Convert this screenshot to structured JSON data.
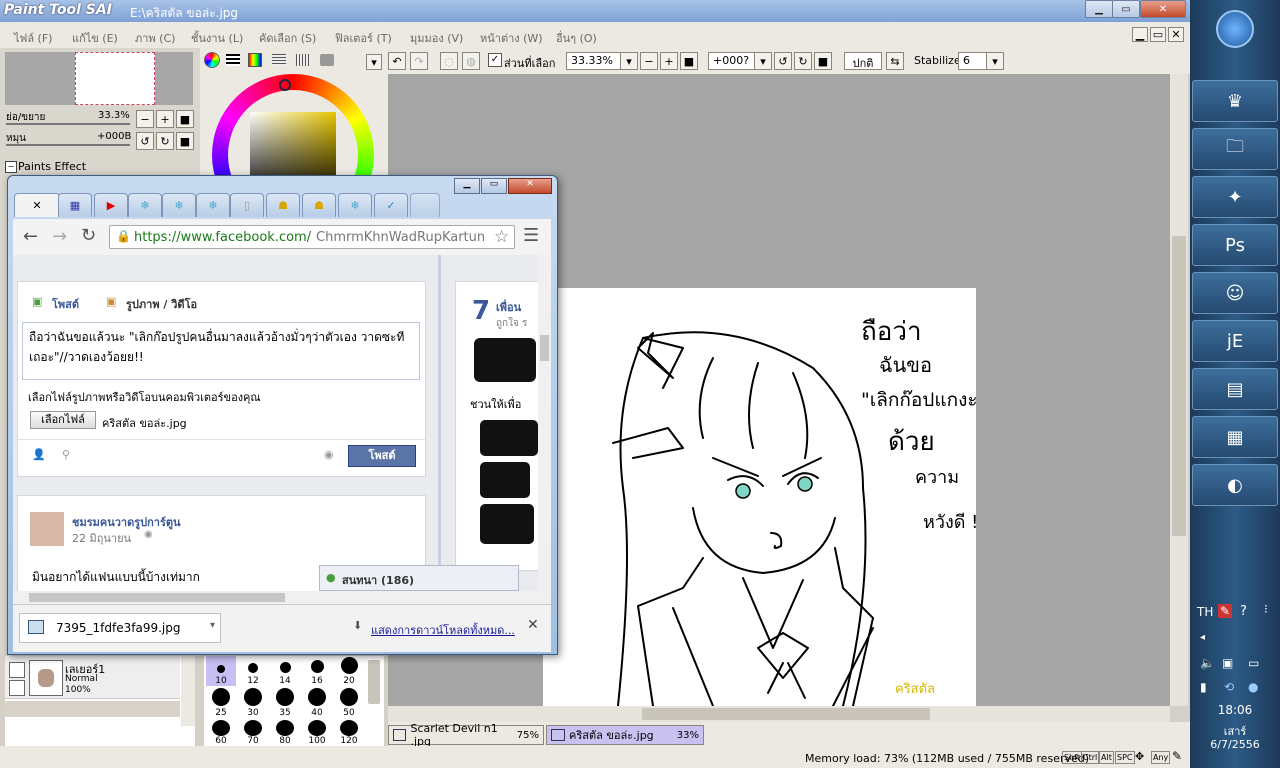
{
  "sai": {
    "logo": "Paint Tool SAI",
    "file_path": "E:\\คริสตัล ขอล่ะ.jpg",
    "menu": [
      "ไฟล์ (F)",
      "แก้ไข (E)",
      "ภาพ (C)",
      "ชั้นงาน (L)",
      "คัดเลือก (S)",
      "ฟิลเตอร์ (T)",
      "มุมมอง (V)",
      "หน้าต่าง (W)",
      "อื่นๆ (O)"
    ],
    "toolbar": {
      "selection_label": "ส่วนที่เลือก",
      "zoom": "33.33%",
      "rotation": "+000?",
      "mode": "ปกติ",
      "stabilize_label": "Stabilize",
      "stabilize_value": "6"
    },
    "navigator": {
      "zoom_label": "ย่อ/ขยาย",
      "zoom_value": "33.3%",
      "rotate_label": "หมุน",
      "rotate_value": "+000B",
      "paints_effect": "Paints Effect"
    },
    "layer": {
      "name": "เลเยอร์1",
      "mode": "Normal",
      "opacity": "100%"
    },
    "brush_sizes": [
      "10",
      "12",
      "14",
      "16",
      "20",
      "25",
      "30",
      "35",
      "40",
      "50",
      "60",
      "70",
      "80",
      "100",
      "120"
    ],
    "doc_tabs": [
      {
        "name": "Scarlet Devil n1 .jpg",
        "zoom": "75%"
      },
      {
        "name": "คริสตัล ขอล่ะ.jpg",
        "zoom": "33%"
      }
    ],
    "status": "Memory load: 73% (112MB used / 755MB reserved)",
    "status_keys": [
      "Shft",
      "Ctrl",
      "Alt",
      "SPC",
      "Any"
    ],
    "canvas_text": {
      "line1": "ถือว่า",
      "line2": "ฉันขอ",
      "line3": "\"เลิกก๊อปแกงะ",
      "line4": "ด้วย",
      "line5": "ความ",
      "line6": "หวังดี !",
      "signature": "คริสตัล"
    }
  },
  "browser": {
    "url_host": "https://www.facebook.com/",
    "url_path": "ChmrmKhnWadRupKartun",
    "composer": {
      "tab_post": "โพสต์",
      "tab_photo": "รูปภาพ / วิดีโอ",
      "text": "ถือว่าฉันขอแล้วนะ \"เลิกก๊อปรูปคนอื่นมาลงแล้วอ้างมั่วๆว่าตัวเอง วาดซะทีเถอะ\"//วาดเองว้อยย!!",
      "choose_prompt": "เลือกไฟล์รูปภาพหรือวิดีโอบนคอมพิวเตอร์ของคุณ",
      "choose_button": "เลือกไฟล์",
      "chosen_file": "คริสตัล ขอล่ะ.jpg",
      "post_button": "โพสต์"
    },
    "feed_post": {
      "page_name": "ชมรมคนวาดรูปการ์ตูน",
      "date": "22 มิถุนายน",
      "text": "มินอยากได้แฟนแบบนี้บ้างเท่มาก"
    },
    "friends": {
      "count": "7",
      "label": "เพื่อน",
      "liked": "ถูกใจ ร",
      "invite": "ชวนให้เพื่อ"
    },
    "chat": "สนทนา (186)",
    "download": {
      "file": "7395_1fdfe3fa99.jpg",
      "show_all": "แสดงการดาวน์โหลดทั้งหมด..."
    }
  },
  "taskbar": {
    "time": "18:06",
    "day": "เสาร์",
    "date": "6/7/2556",
    "lang": "TH"
  }
}
